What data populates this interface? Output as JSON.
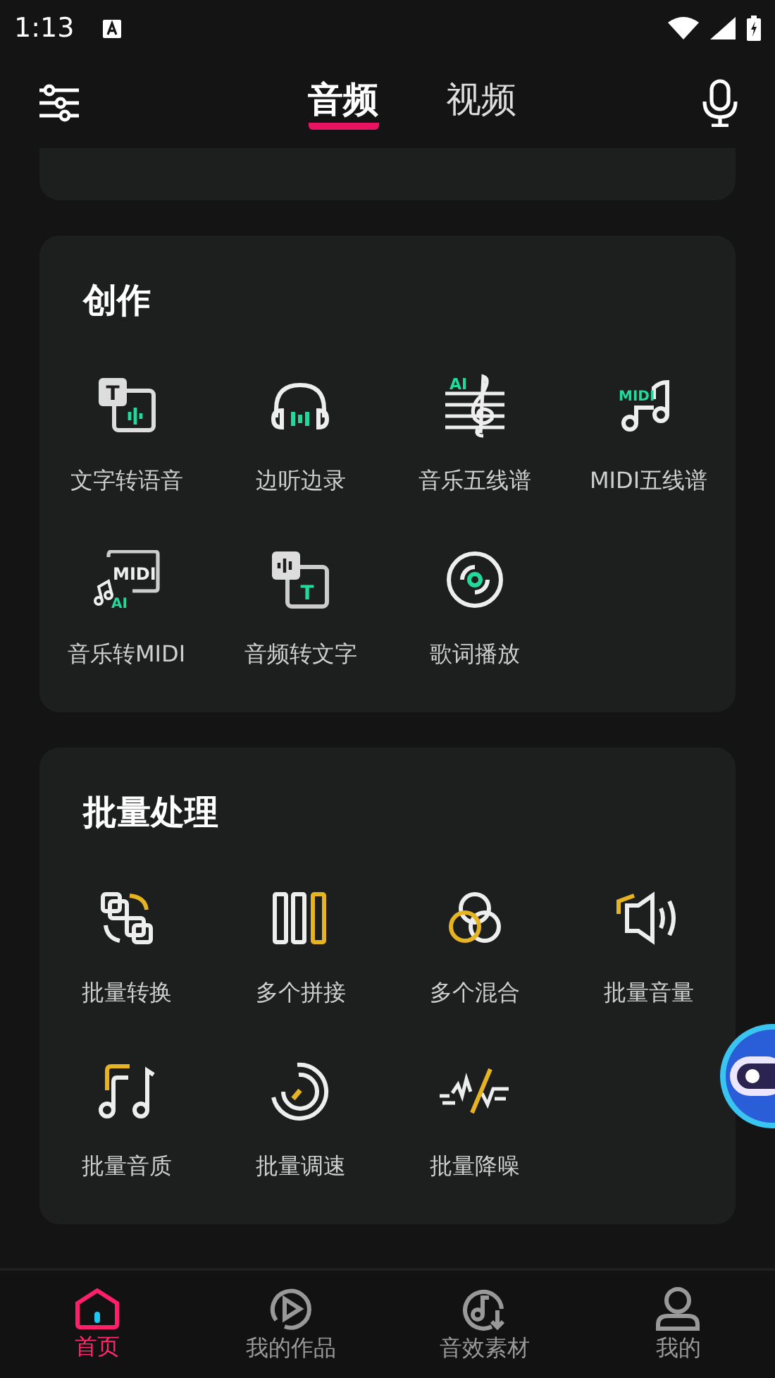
{
  "status_bar": {
    "time": "1:13"
  },
  "tabs": [
    {
      "label": "音频",
      "selected": true
    },
    {
      "label": "视频",
      "selected": false
    }
  ],
  "sections": [
    {
      "title": "创作",
      "items": [
        {
          "label": "文字转语音",
          "icon_texts": [
            "T"
          ]
        },
        {
          "label": "边听边录"
        },
        {
          "label": "音乐五线谱",
          "icon_texts": [
            "AI"
          ]
        },
        {
          "label": "MIDI五线谱",
          "icon_texts": [
            "MIDI"
          ]
        },
        {
          "label": "音乐转MIDI",
          "icon_texts": [
            "MIDI",
            "AI"
          ]
        },
        {
          "label": "音频转文字",
          "icon_texts": [
            "T"
          ]
        },
        {
          "label": "歌词播放"
        }
      ]
    },
    {
      "title": "批量处理",
      "items": [
        {
          "label": "批量转换"
        },
        {
          "label": "多个拼接"
        },
        {
          "label": "多个混合"
        },
        {
          "label": "批量音量"
        },
        {
          "label": "批量音质"
        },
        {
          "label": "批量调速"
        },
        {
          "label": "批量降噪"
        }
      ]
    }
  ],
  "nav": [
    {
      "label": "首页",
      "selected": true
    },
    {
      "label": "我的作品",
      "selected": false
    },
    {
      "label": "音效素材",
      "selected": false
    },
    {
      "label": "我的",
      "selected": false
    }
  ]
}
